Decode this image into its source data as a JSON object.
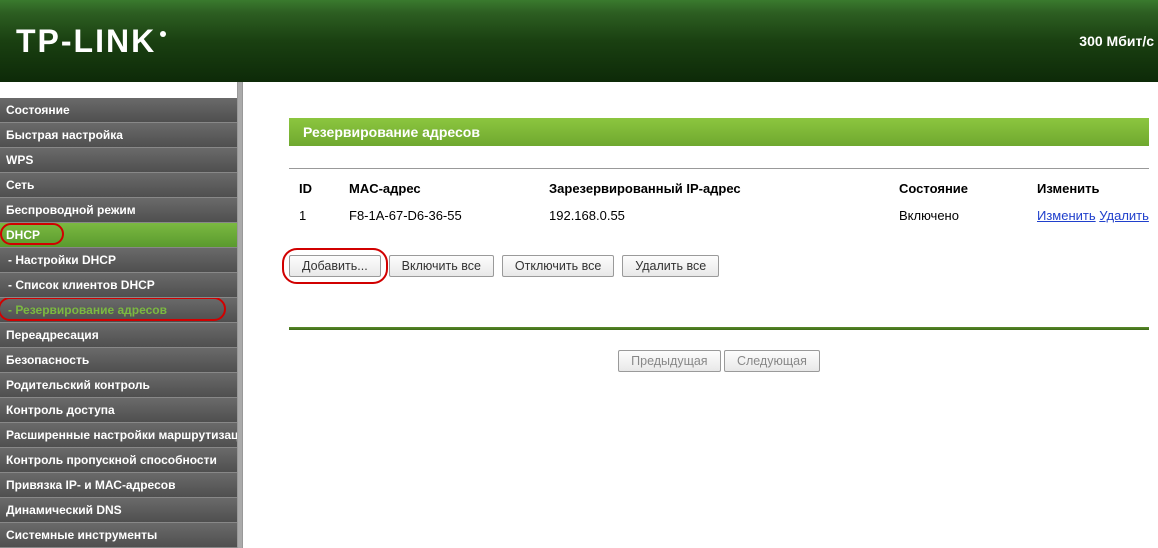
{
  "header": {
    "brand": "TP-LINK",
    "right_text": "300 Мбит/с"
  },
  "sidebar": {
    "items": [
      {
        "label": "Состояние",
        "type": "top"
      },
      {
        "label": "Быстрая настройка",
        "type": "top"
      },
      {
        "label": "WPS",
        "type": "top"
      },
      {
        "label": "Сеть",
        "type": "top"
      },
      {
        "label": "Беспроводной режим",
        "type": "top"
      },
      {
        "label": "DHCP",
        "type": "top",
        "active_parent": true
      },
      {
        "label": "- Настройки DHCP",
        "type": "sub"
      },
      {
        "label": "- Список клиентов DHCP",
        "type": "sub"
      },
      {
        "label": "- Резервирование адресов",
        "type": "sub",
        "active_sub": true
      },
      {
        "label": "Переадресация",
        "type": "top"
      },
      {
        "label": "Безопасность",
        "type": "top"
      },
      {
        "label": "Родительский контроль",
        "type": "top"
      },
      {
        "label": "Контроль доступа",
        "type": "top"
      },
      {
        "label": "Расширенные настройки маршрутизации",
        "type": "top"
      },
      {
        "label": "Контроль пропускной способности",
        "type": "top"
      },
      {
        "label": "Привязка IP- и МАС-адресов",
        "type": "top"
      },
      {
        "label": "Динамический DNS",
        "type": "top"
      },
      {
        "label": "Системные инструменты",
        "type": "top"
      }
    ]
  },
  "page": {
    "title": "Резервирование адресов",
    "columns": {
      "id": "ID",
      "mac": "MAC-адрес",
      "ip": "Зарезервированный IP-адрес",
      "status": "Состояние",
      "modify": "Изменить"
    },
    "rows": [
      {
        "id": "1",
        "mac": "F8-1A-67-D6-36-55",
        "ip": "192.168.0.55",
        "status": "Включено",
        "edit": "Изменить",
        "delete": "Удалить"
      }
    ],
    "buttons": {
      "add": "Добавить...",
      "enable_all": "Включить все",
      "disable_all": "Отключить все",
      "delete_all": "Удалить все",
      "prev": "Предыдущая",
      "next": "Следующая"
    }
  }
}
